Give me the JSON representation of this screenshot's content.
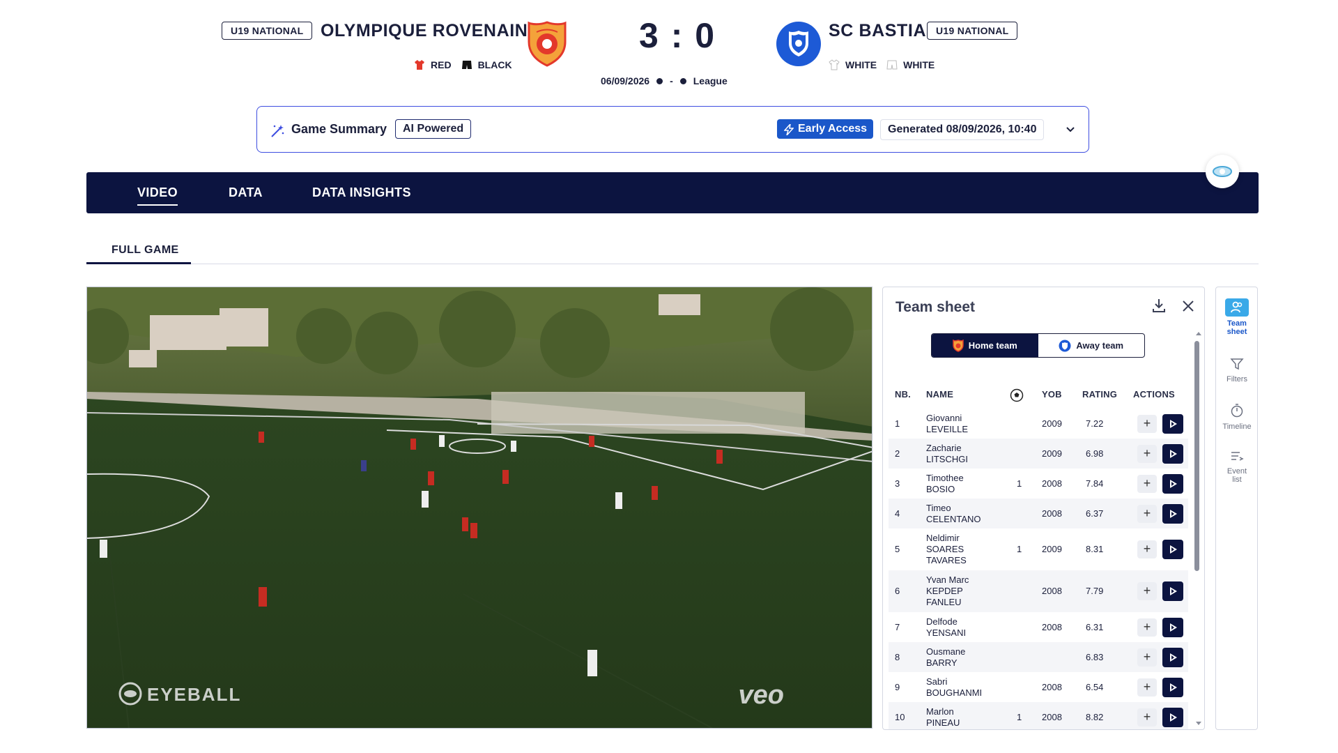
{
  "match": {
    "home": {
      "badge": "U19 NATIONAL",
      "name": "OLYMPIQUE ROVENAIN",
      "kit_shirt": "RED",
      "kit_shorts": "BLACK"
    },
    "away": {
      "badge": "U19 NATIONAL",
      "name": "SC BASTIA",
      "kit_shirt": "WHITE",
      "kit_shorts": "WHITE"
    },
    "score": "3 : 0",
    "date": "06/09/2026",
    "separator": "-",
    "competition": "League"
  },
  "summary": {
    "title": "Game Summary",
    "ai_badge": "AI Powered",
    "early_access": "Early Access",
    "generated": "Generated 08/09/2026, 10:40"
  },
  "nav": {
    "tabs": [
      "VIDEO",
      "DATA",
      "DATA INSIGHTS"
    ]
  },
  "subtab": "FULL GAME",
  "video": {
    "watermark_left": "EYEBALL",
    "watermark_right": "veo"
  },
  "team_sheet": {
    "title": "Team sheet",
    "home_tab": "Home team",
    "away_tab": "Away team",
    "columns": [
      "NB.",
      "NAME",
      "YOB",
      "RATING",
      "ACTIONS"
    ],
    "rows": [
      {
        "nb": "1",
        "first": "Giovanni",
        "last": "LEVEILLE",
        "goals": "",
        "yob": "2009",
        "rating": "7.22"
      },
      {
        "nb": "2",
        "first": "Zacharie",
        "last": "LITSCHGI",
        "goals": "",
        "yob": "2009",
        "rating": "6.98"
      },
      {
        "nb": "3",
        "first": "Timothee",
        "last": "BOSIO",
        "goals": "1",
        "yob": "2008",
        "rating": "7.84"
      },
      {
        "nb": "4",
        "first": "Timeo",
        "last": "CELENTANO",
        "goals": "",
        "yob": "2008",
        "rating": "6.37"
      },
      {
        "nb": "5",
        "first": "Neldimir",
        "last": "SOARES TAVARES",
        "goals": "1",
        "yob": "2009",
        "rating": "8.31"
      },
      {
        "nb": "6",
        "first": "Yvan Marc",
        "last": "KEPDEP FANLEU",
        "goals": "",
        "yob": "2008",
        "rating": "7.79"
      },
      {
        "nb": "7",
        "first": "Delfode",
        "last": "YENSANI",
        "goals": "",
        "yob": "2008",
        "rating": "6.31"
      },
      {
        "nb": "8",
        "first": "Ousmane",
        "last": "BARRY",
        "goals": "",
        "yob": "",
        "rating": "6.83"
      },
      {
        "nb": "9",
        "first": "Sabri",
        "last": "BOUGHANMI",
        "goals": "",
        "yob": "2008",
        "rating": "6.54"
      },
      {
        "nb": "10",
        "first": "Marlon",
        "last": "PINEAU",
        "goals": "1",
        "yob": "2008",
        "rating": "8.82"
      }
    ]
  },
  "rail": {
    "team_sheet": "Team sheet",
    "filters": "Filters",
    "timeline": "Timeline",
    "event_list": "Event list"
  },
  "colors": {
    "navy": "#0c1440",
    "accent": "#1a57c9",
    "home_red": "#e3382b",
    "away_blue": "#1d5ad6"
  }
}
